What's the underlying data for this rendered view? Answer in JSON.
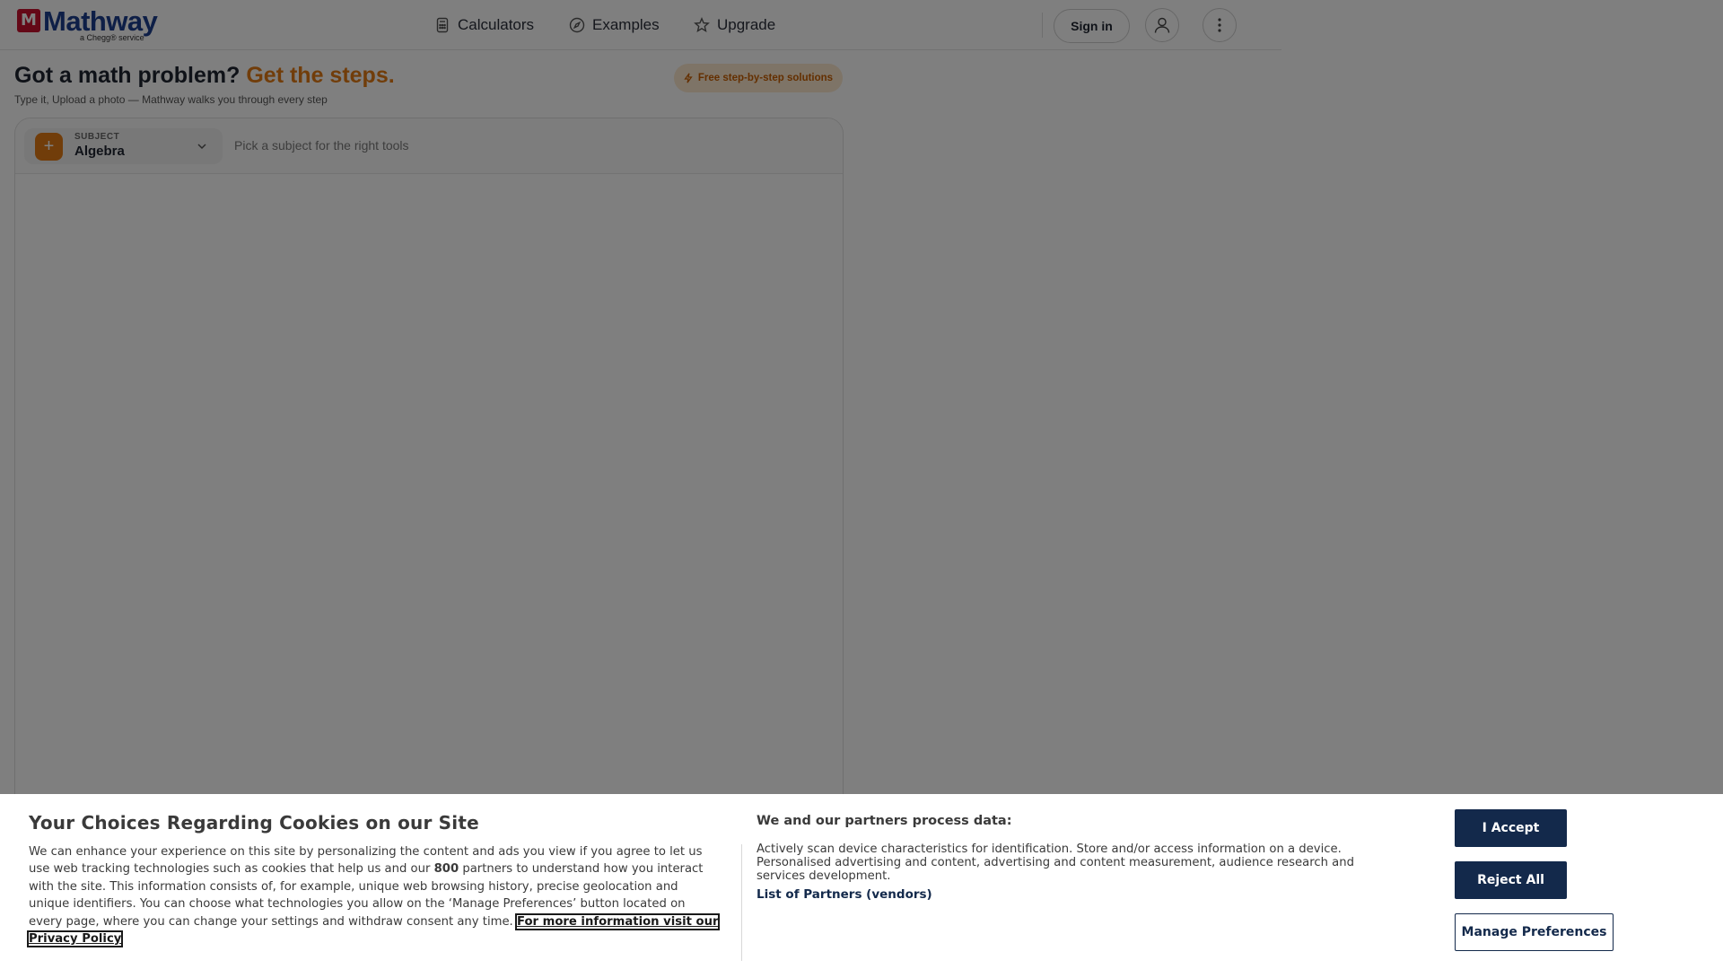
{
  "header": {
    "logo_mark": "M",
    "logo_text": "Mathway",
    "logo_sub": "a Chegg® service",
    "nav": [
      {
        "label": "Calculators",
        "icon": "calculator-icon"
      },
      {
        "label": "Examples",
        "icon": "compass-icon"
      },
      {
        "label": "Upgrade",
        "icon": "star-icon"
      }
    ],
    "sign_in": "Sign in"
  },
  "hero": {
    "title": "Got a math problem?",
    "title_accent": "Get the steps.",
    "subtitle": "Type it, Upload a photo — Mathway walks you through every step",
    "badge": "Free step-by-step solutions"
  },
  "subject": {
    "label": "SUBJECT",
    "value": "Algebra",
    "hint": "Pick a subject for the right tools"
  },
  "cookie": {
    "title": "Your Choices Regarding Cookies on our Site",
    "body_part1": "We can enhance your experience on this site by personalizing the content and ads you view if you agree to let us use web tracking technologies such as cookies that help us and our",
    "partner_count": "800",
    "body_part2": "partners to understand how you interact with the site. This information consists of, for example, unique web browsing history, precise geolocation and unique identifiers. You can choose what technologies you allow on the ‘Manage Preferences’ button located on every page, where you can change your settings and withdraw consent any time.",
    "privacy_link": "For more information visit our Privacy Policy",
    "right_title": "We and our partners process data:",
    "right_body": "Actively scan device characteristics for identification. Store and/or access information on a device. Personalised advertising and content, advertising and content measurement, audience research and services development.",
    "partners_link": "List of Partners (vendors)",
    "accept": "I Accept",
    "reject": "Reject All",
    "manage": "Manage Preferences"
  },
  "colors": {
    "brand_blue": "#1d3f8f",
    "brand_red": "#c8102e",
    "accent_orange": "#e37b14",
    "button_navy": "#13294b"
  }
}
